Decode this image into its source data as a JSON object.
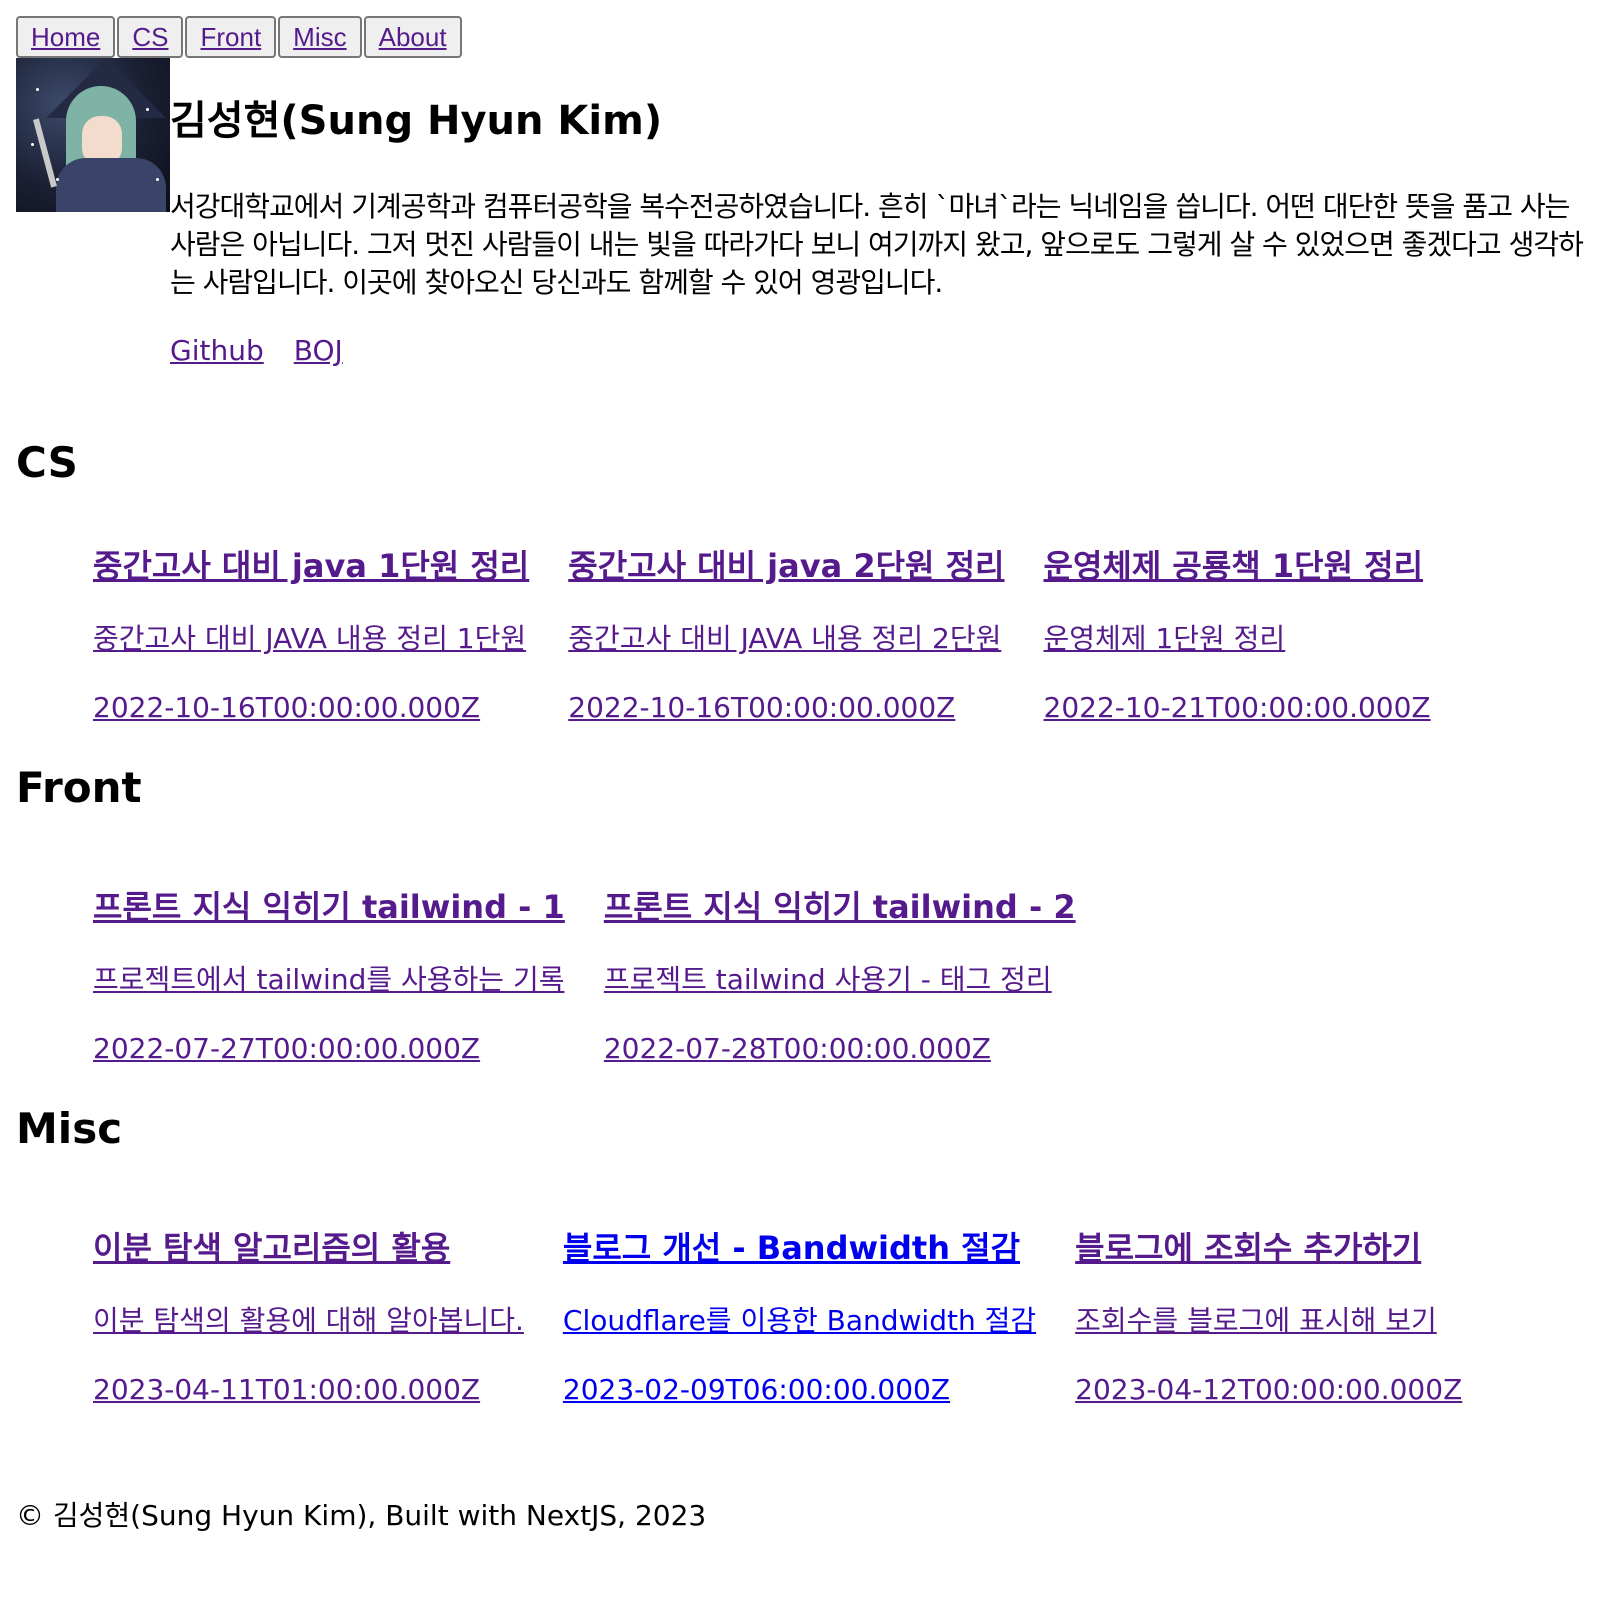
{
  "nav": [
    "Home",
    "CS",
    "Front",
    "Misc",
    "About"
  ],
  "profile": {
    "name": "김성현(Sung Hyun Kim)",
    "bio": "서강대학교에서 기계공학과 컴퓨터공학을 복수전공하였습니다. 흔히 `마녀`라는 닉네임을 씁니다. 어떤 대단한 뜻을 품고 사는 사람은 아닙니다. 그저 멋진 사람들이 내는 빛을 따라가다 보니 여기까지 왔고, 앞으로도 그렇게 살 수 있었으면 좋겠다고 생각하는 사람입니다. 이곳에 찾아오신 당신과도 함께할 수 있어 영광입니다.",
    "links": [
      "Github",
      "BOJ"
    ]
  },
  "sections": [
    {
      "title": "CS",
      "posts": [
        {
          "title": "중간고사 대비 java 1단원 정리",
          "desc": "중간고사 대비 JAVA 내용 정리 1단원",
          "date": "2022-10-16T00:00:00.000Z"
        },
        {
          "title": "중간고사 대비 java 2단원 정리",
          "desc": "중간고사 대비 JAVA 내용 정리 2단원",
          "date": "2022-10-16T00:00:00.000Z"
        },
        {
          "title": "운영체제 공룡책 1단원 정리",
          "desc": "운영체제 1단원 정리",
          "date": "2022-10-21T00:00:00.000Z"
        }
      ]
    },
    {
      "title": "Front",
      "posts": [
        {
          "title": "프론트 지식 익히기 tailwind - 1",
          "desc": "프로젝트에서 tailwind를 사용하는 기록",
          "date": "2022-07-27T00:00:00.000Z"
        },
        {
          "title": "프론트 지식 익히기 tailwind - 2",
          "desc": "프로젝트 tailwind 사용기 - 태그 정리",
          "date": "2022-07-28T00:00:00.000Z"
        }
      ]
    },
    {
      "title": "Misc",
      "posts": [
        {
          "title": "이분 탐색 알고리즘의 활용",
          "desc": "이분 탐색의 활용에 대해 알아봅니다.",
          "date": "2023-04-11T01:00:00.000Z"
        },
        {
          "title": "블로그 개선 - Bandwidth 절감",
          "desc": "Cloudflare를 이용한 Bandwidth 절감",
          "date": "2023-02-09T06:00:00.000Z"
        },
        {
          "title": "블로그에 조회수 추가하기",
          "desc": "조회수를 블로그에 표시해 보기",
          "date": "2023-04-12T00:00:00.000Z"
        }
      ]
    }
  ],
  "footer": "© 김성현(Sung Hyun Kim), Built with NextJS, 2023"
}
